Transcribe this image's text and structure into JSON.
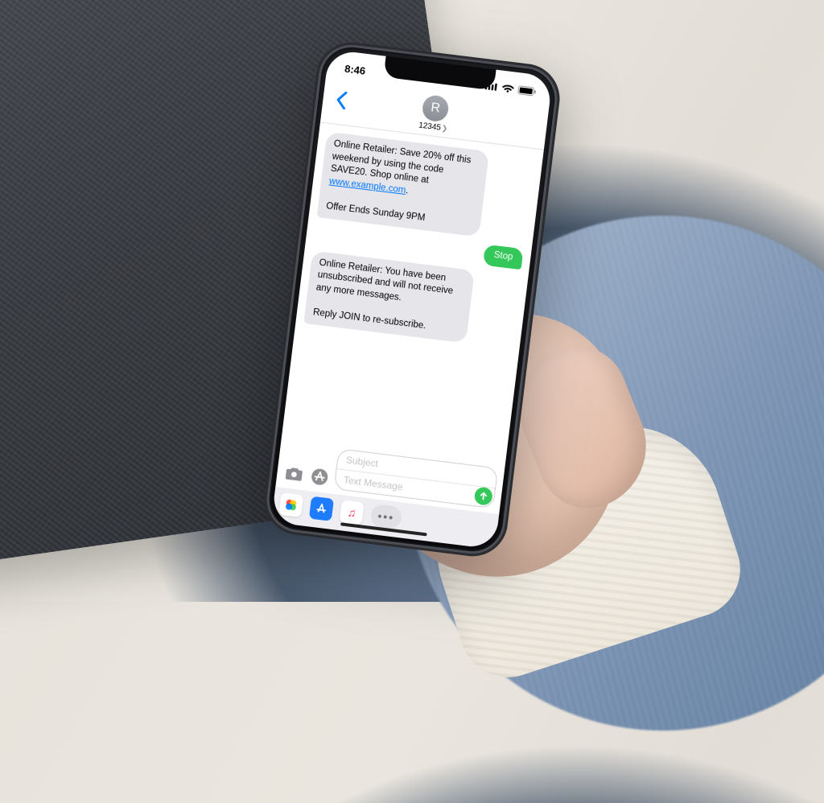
{
  "statusbar": {
    "time": "8:46"
  },
  "nav": {
    "avatar_initial": "R",
    "contact_number": "12345"
  },
  "messages": {
    "incoming1_pre": "Online Retailer: Save 20% off this weekend by using the code SAVE20. Shop online at ",
    "incoming1_link": "www.example.com",
    "incoming1_post": ".\n\nOffer Ends Sunday 9PM",
    "outgoing1": "Stop",
    "incoming2": "Online Retailer: You have been unsubscribed and will not receive any more messages.\n\nReply JOIN to re-subscribe."
  },
  "compose": {
    "subject_placeholder": "Subject",
    "message_placeholder": "Text Message"
  }
}
